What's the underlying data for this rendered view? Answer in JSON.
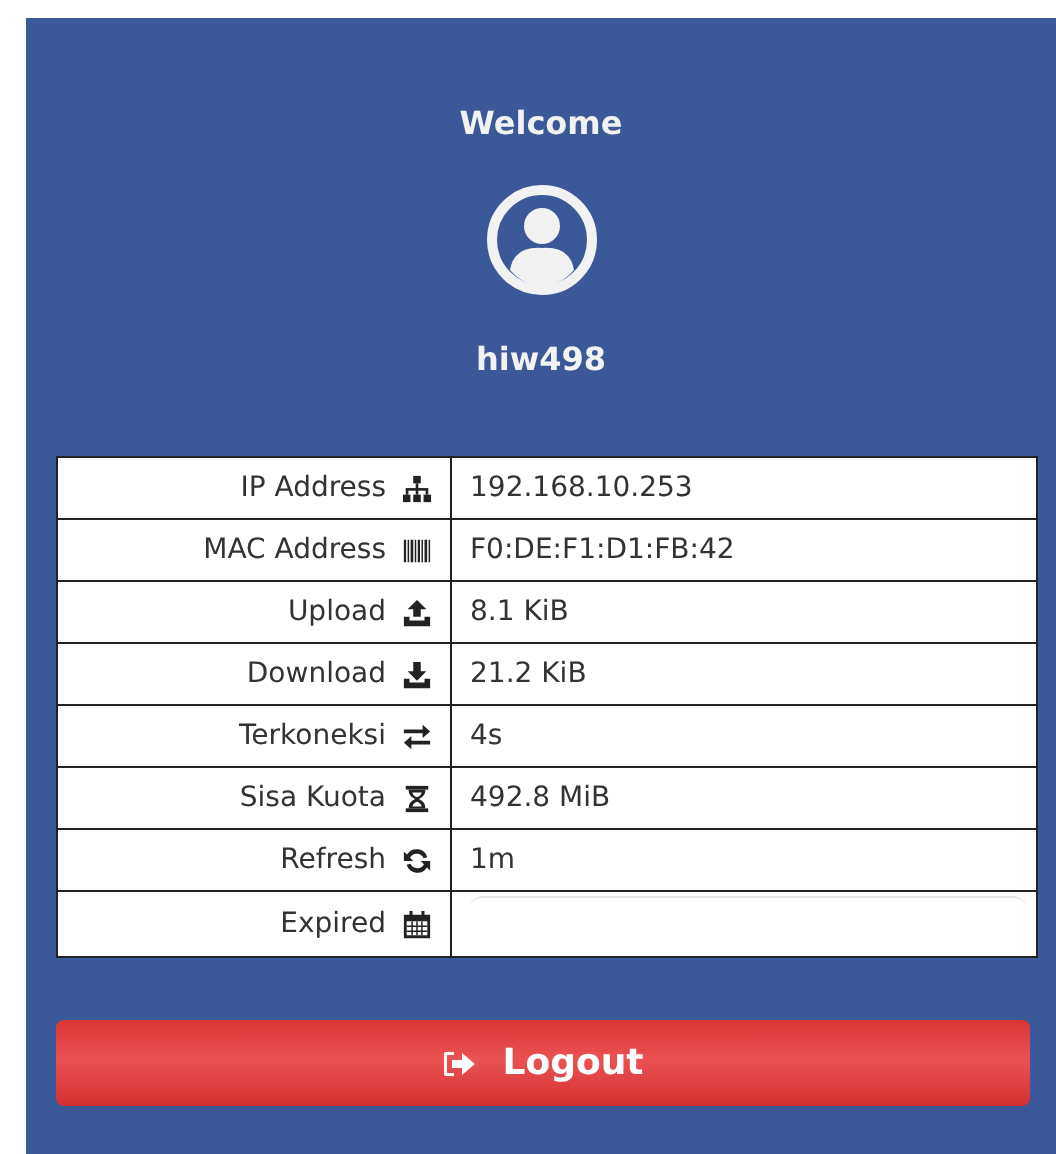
{
  "greeting": "Welcome",
  "username": "hiw498",
  "rows": [
    {
      "kind": "network",
      "label": "IP Address",
      "value": "192.168.10.253"
    },
    {
      "kind": "barcode",
      "label": "MAC Address",
      "value": "F0:DE:F1:D1:FB:42"
    },
    {
      "kind": "upload",
      "label": "Upload",
      "value": "8.1 KiB"
    },
    {
      "kind": "download",
      "label": "Download",
      "value": "21.2 KiB"
    },
    {
      "kind": "exchange",
      "label": "Terkoneksi",
      "value": "4s"
    },
    {
      "kind": "hourglass",
      "label": "Sisa Kuota",
      "value": "492.8 MiB"
    },
    {
      "kind": "refresh",
      "label": "Refresh",
      "value": "1m"
    },
    {
      "kind": "calendar",
      "label": "Expired"
    }
  ],
  "logout_button": {
    "label": "Logout"
  }
}
